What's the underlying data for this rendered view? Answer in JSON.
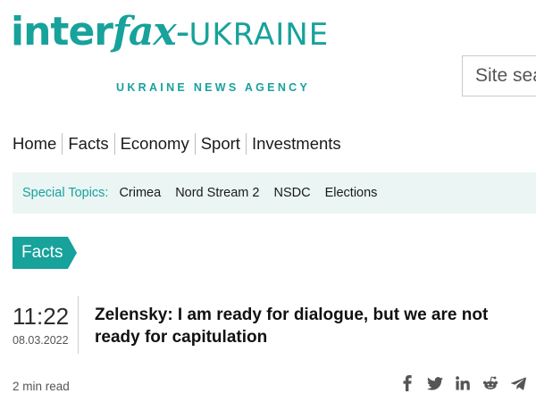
{
  "header": {
    "logo": {
      "brand_part1": "inter",
      "brand_part2": "fax",
      "dash": "-",
      "country": "UKRAINE",
      "tagline": "UKRAINE NEWS AGENCY"
    },
    "search": {
      "placeholder": "Site search"
    }
  },
  "nav": {
    "items": [
      "Home",
      "Facts",
      "Economy",
      "Sport",
      "Investments"
    ]
  },
  "topics": {
    "label": "Special Topics:",
    "items": [
      "Crimea",
      "Nord Stream 2",
      "NSDC",
      "Elections"
    ]
  },
  "section": {
    "tag": "Facts"
  },
  "article": {
    "time": "11:22",
    "date": "08.03.2022",
    "title": "Zelensky: I am ready for dialogue, but we are not ready for capitulation",
    "read_time": "2 min read"
  },
  "share": {
    "icons": [
      "facebook-icon",
      "twitter-icon",
      "linkedin-icon",
      "reddit-icon",
      "telegram-icon"
    ]
  },
  "colors": {
    "accent": "#17a29b",
    "topics_bg": "#eaf5f4",
    "icon": "#555555"
  }
}
